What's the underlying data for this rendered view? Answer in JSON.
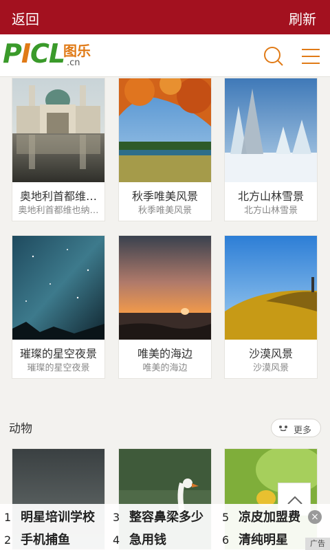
{
  "topbar": {
    "back_label": "返回",
    "refresh_label": "刷新",
    "color": "#a3111f"
  },
  "logo": {
    "letters_p": "P",
    "letters_i": "I",
    "letters_cl": "CL",
    "brand_cn": "图乐",
    "domain": ".cn"
  },
  "row1": [
    {
      "title": "奥地利首都维…",
      "subtitle": "奥地利首都维也纳…"
    },
    {
      "title": "秋季唯美风景",
      "subtitle": "秋季唯美风景"
    },
    {
      "title": "北方山林雪景",
      "subtitle": "北方山林雪景"
    }
  ],
  "row2": [
    {
      "title": "璀璨的星空夜景",
      "subtitle": "璀璨的星空夜景"
    },
    {
      "title": "唯美的海边",
      "subtitle": "唯美的海边"
    },
    {
      "title": "沙漠风景",
      "subtitle": "沙漠风景"
    }
  ],
  "section": {
    "title": "动物",
    "more_label": "更多"
  },
  "ad": {
    "items": [
      {
        "num": "1",
        "text": "明星培训学校"
      },
      {
        "num": "3",
        "text": "整容鼻梁多少"
      },
      {
        "num": "5",
        "text": "凉皮加盟费"
      },
      {
        "num": "2",
        "text": "手机捕鱼"
      },
      {
        "num": "4",
        "text": "急用钱"
      },
      {
        "num": "6",
        "text": "清纯明星"
      }
    ],
    "close_label": "×",
    "tag": "广告"
  },
  "icons": {
    "search": "search-icon",
    "menu": "menu-icon",
    "back_to_top": "chevron-up-icon"
  }
}
